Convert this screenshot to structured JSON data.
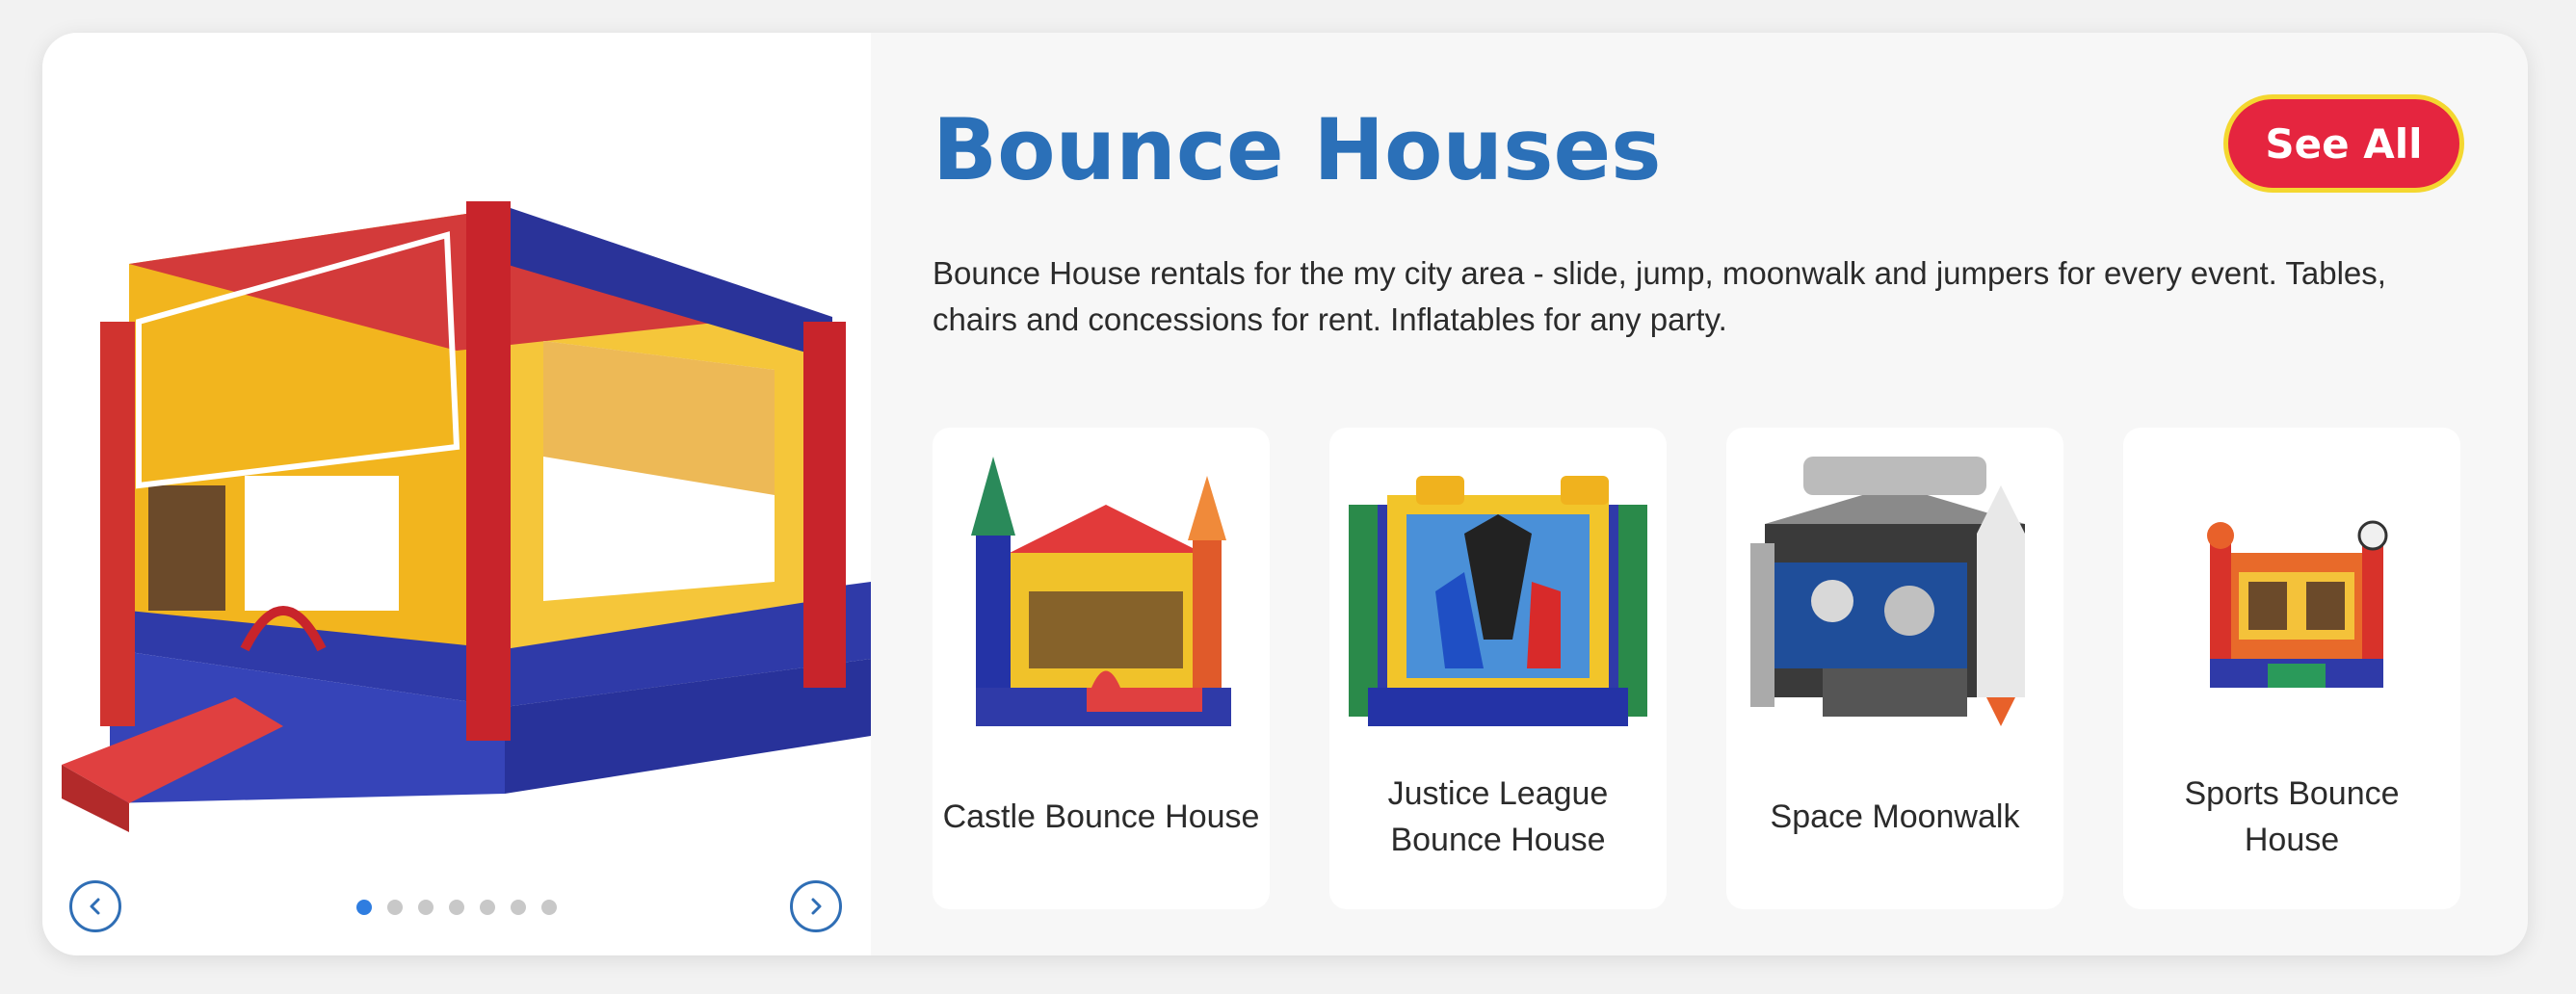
{
  "section": {
    "title": "Bounce Houses",
    "see_all_label": "See All",
    "description": "Bounce House rentals for the my city area - slide, jump, moonwalk and jumpers for every event. Tables, chairs and concessions for rent. Inflatables for any party."
  },
  "carousel": {
    "slide_count": 7,
    "active_slide": 1
  },
  "products": [
    {
      "name": "Castle Bounce House"
    },
    {
      "name": "Justice League Bounce House"
    },
    {
      "name": "Space Moonwalk"
    },
    {
      "name": "Sports Bounce House"
    }
  ],
  "colors": {
    "title": "#2b70b8",
    "see_all_bg": "#e5253f",
    "see_all_border": "#f4d730",
    "nav": "#2f6eb5",
    "dot_active": "#2f7de0"
  }
}
